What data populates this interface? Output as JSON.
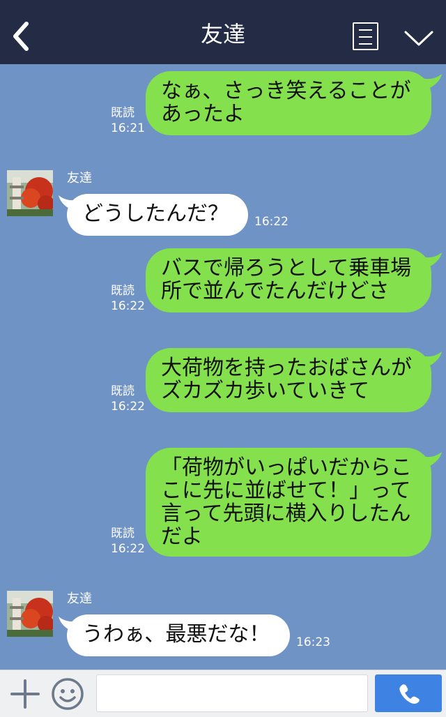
{
  "header": {
    "title": "友達",
    "back_icon": "chevron-left-icon",
    "menu_icon": "menu-list-icon",
    "collapse_icon": "chevron-down-icon",
    "background": "#232b45"
  },
  "chat": {
    "background": "#7093c6",
    "bubble_out_color": "#84e04c",
    "bubble_in_color": "#ffffff",
    "messages": [
      {
        "direction": "out",
        "lines": [
          "なぁ、さっき笑えることが",
          "あったよ"
        ],
        "read": "既読",
        "time": "16:21"
      },
      {
        "direction": "in",
        "sender": "友達",
        "lines": [
          "どうしたんだ？"
        ],
        "time": "16:22"
      },
      {
        "direction": "out",
        "lines": [
          "バスで帰ろうとして乗車場",
          "所で並んでたんだけどさ"
        ],
        "read": "既読",
        "time": "16:22"
      },
      {
        "direction": "out",
        "lines": [
          "大荷物を持ったおばさんが",
          "ズカズカ歩いていきて"
        ],
        "read": "既読",
        "time": "16:22"
      },
      {
        "direction": "out",
        "lines": [
          "「荷物がいっぱいだからこ",
          "こに先に並ばせて！」って",
          "言って先頭に横入りしたん",
          "だよ"
        ],
        "read": "既読",
        "time": "16:22"
      },
      {
        "direction": "in",
        "sender": "友達",
        "lines": [
          "うわぁ、最悪だな！"
        ],
        "time": "16:23"
      }
    ]
  },
  "input_bar": {
    "plus_icon": "plus-icon",
    "emoji_icon": "smiley-icon",
    "input_value": "",
    "input_placeholder": "",
    "call_icon": "phone-icon",
    "call_color": "#3e83e3"
  }
}
